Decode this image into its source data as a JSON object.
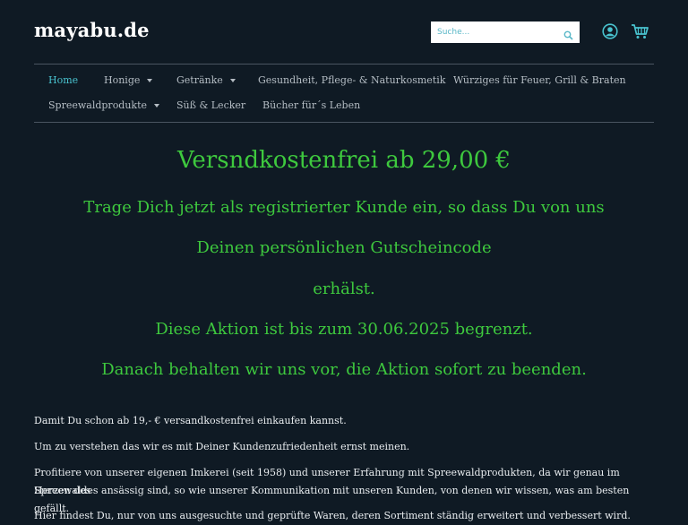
{
  "header": {
    "logo": "mayabu.de",
    "search_placeholder": "Suche...",
    "icons": [
      "search-icon",
      "user-icon",
      "cart-icon"
    ]
  },
  "nav": {
    "items": [
      {
        "label": "Home",
        "active": true,
        "dropdown": false
      },
      {
        "label": "Honige",
        "active": false,
        "dropdown": true
      },
      {
        "label": "Getränke",
        "active": false,
        "dropdown": true
      },
      {
        "label": "Gesundheit, Pflege- & Naturkosmetik",
        "active": false,
        "dropdown": false
      },
      {
        "label": "Würziges für Feuer, Grill & Braten",
        "active": false,
        "dropdown": false
      },
      {
        "label": "Spreewaldprodukte",
        "active": false,
        "dropdown": true
      },
      {
        "label": "Süß & Lecker",
        "active": false,
        "dropdown": false
      },
      {
        "label": "Bücher für´s Leben",
        "active": false,
        "dropdown": false
      }
    ]
  },
  "promo": {
    "title": "Versndkostenfrei ab 29,00 €",
    "lines": [
      "Trage Dich jetzt als registrierter Kunde ein, so dass Du von uns",
      "Deinen persönlichen Gutscheincode",
      "erhälst.",
      "Diese Aktion ist bis zum 30.06.2025 begrenzt.",
      "Danach behalten wir uns vor, die Aktion sofort zu beenden."
    ]
  },
  "content": {
    "paragraphs": [
      "Damit Du schon ab 19,- € versandkostenfrei einkaufen kannst.",
      "Um zu verstehen das wir es mit Deiner Kundenzufriedenheit ernst meinen.",
      "Profitiere von unserer eigenen Imkerei (seit 1958) und unserer Erfahrung mit Spreewaldprodukten, da wir genau im Herzen des",
      "Spreewaldes ansässig sind, so wie unserer Kommunikation mit unseren Kunden, von denen wir wissen, was am besten gefällt.",
      "Hier findest Du, nur von uns ausgesuchte und geprüfte Waren, deren Sortiment ständig erweitert und verbessert wird."
    ]
  },
  "colors": {
    "background": "#0f1a24",
    "accent": "#49c3cf",
    "promo_green": "#3ec93e"
  }
}
